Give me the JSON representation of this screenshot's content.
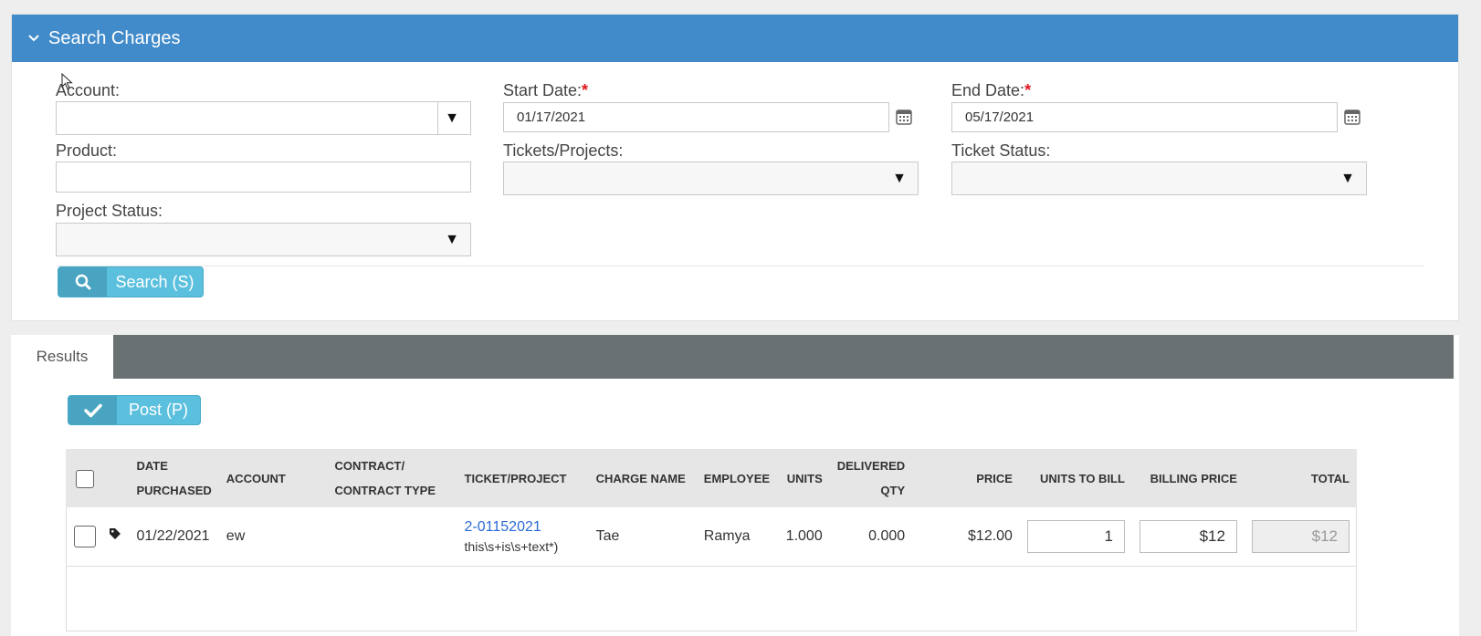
{
  "search_panel": {
    "title": "Search Charges",
    "fields": {
      "account": {
        "label": "Account:",
        "value": ""
      },
      "start_date": {
        "label": "Start Date:",
        "required_mark": "*",
        "value": "01/17/2021"
      },
      "end_date": {
        "label": "End Date:",
        "required_mark": "*",
        "value": "05/17/2021"
      },
      "product": {
        "label": "Product:",
        "value": ""
      },
      "tickets_projects": {
        "label": "Tickets/Projects:",
        "value": ""
      },
      "ticket_status": {
        "label": "Ticket Status:",
        "value": ""
      },
      "project_status": {
        "label": "Project Status:",
        "value": ""
      }
    },
    "search_button": {
      "label": "Search (S)",
      "icon": "search-icon"
    }
  },
  "results": {
    "tab_label": "Results",
    "post_button": {
      "label": "Post (P)",
      "icon": "check-icon"
    },
    "columns": [
      {
        "line1": "DATE",
        "line2": "PURCHASED"
      },
      {
        "line1": "ACCOUNT",
        "line2": ""
      },
      {
        "line1": "CONTRACT/",
        "line2": "CONTRACT TYPE"
      },
      {
        "line1": "TICKET/PROJECT",
        "line2": ""
      },
      {
        "line1": "CHARGE NAME",
        "line2": ""
      },
      {
        "line1": "EMPLOYEE",
        "line2": ""
      },
      {
        "line1": "UNITS",
        "line2": ""
      },
      {
        "line1": "DELIVERED",
        "line2": "QTY"
      },
      {
        "line1": "PRICE",
        "line2": ""
      },
      {
        "line1": "UNITS TO BILL",
        "line2": ""
      },
      {
        "line1": "BILLING PRICE",
        "line2": ""
      },
      {
        "line1": "TOTAL",
        "line2": ""
      }
    ],
    "rows": [
      {
        "date_purchased": "01/22/2021",
        "account": "ew",
        "contract": "",
        "ticket_link": "2-01152021",
        "ticket_desc": "this\\s+is\\s+text*)",
        "charge_name": "Tae",
        "employee": "Ramya",
        "units": "1.000",
        "delivered_qty": "0.000",
        "price": "$12.00",
        "units_to_bill": "1",
        "billing_price": "$12",
        "total": "$12"
      }
    ]
  },
  "colors": {
    "header_blue": "#428bca",
    "tab_bar": "#6a7173",
    "button": "#5bc0de",
    "required": "#e0171f"
  }
}
